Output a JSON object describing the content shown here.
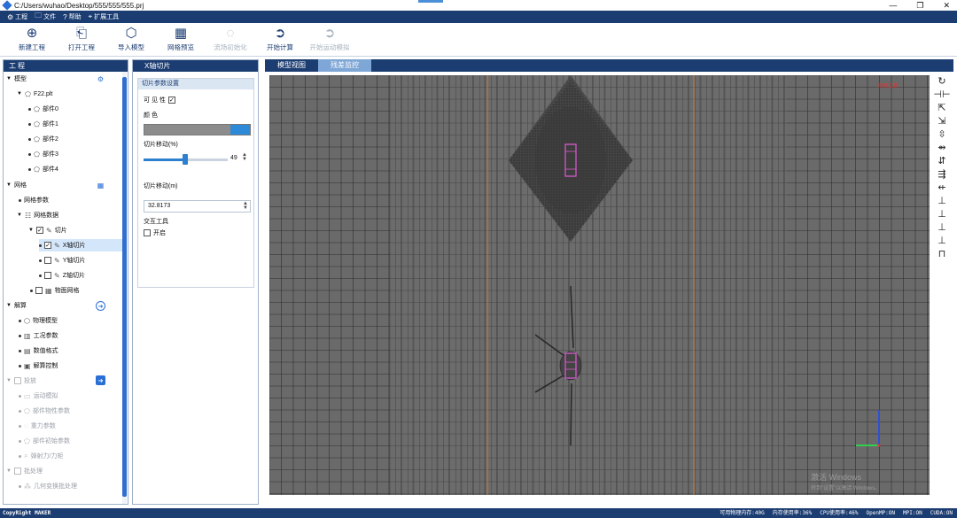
{
  "window": {
    "title": "C:/Users/wuhao/Desktop/555/555/555.prj",
    "controls": [
      "—",
      "❐",
      "✕"
    ]
  },
  "menu": [
    {
      "icon": "⚙",
      "label": "工程"
    },
    {
      "icon": "🗀",
      "label": "文件"
    },
    {
      "icon": "?",
      "label": "帮助"
    },
    {
      "icon": "⌖",
      "label": "扩展工具"
    }
  ],
  "toolbar": [
    {
      "icon": "⊕",
      "label": "新建工程",
      "enabled": true
    },
    {
      "icon": "⎗",
      "label": "打开工程",
      "enabled": true
    },
    {
      "icon": "⬡",
      "label": "导入模型",
      "enabled": true
    },
    {
      "icon": "▦",
      "label": "网格预览",
      "enabled": true
    },
    {
      "icon": "◌",
      "label": "流场初始化",
      "enabled": false
    },
    {
      "icon": "➲",
      "label": "开始计算",
      "enabled": true
    },
    {
      "icon": "➲",
      "label": "开始运动模拟",
      "enabled": false
    }
  ],
  "project_panel": {
    "title": "工程",
    "tree": {
      "model": "模型",
      "file": "F22.plt",
      "parts": [
        "部件0",
        "部件1",
        "部件2",
        "部件3",
        "部件4"
      ],
      "mesh": "网格",
      "mesh_params": "网格参数",
      "mesh_data": "网格数据",
      "slice": "切片",
      "x_slice": "X轴切片",
      "y_slice": "Y轴切片",
      "z_slice": "Z轴切片",
      "object_mesh": "物面网格",
      "solve": "解算",
      "physics_model": "物理模型",
      "conditions": "工况参数",
      "numeric_format": "数值格式",
      "solve_control": "解算控制",
      "motion": "投放",
      "motion_sim": "运动模拟",
      "part_props": "部件物性参数",
      "gravity": "重力参数",
      "part_init": "部件初始参数",
      "ejection": "弹射力/力矩",
      "batch": "批处理",
      "geo_batch": "几何变换批处理"
    }
  },
  "slice_panel": {
    "tab": "X轴切片",
    "group_title": "切片参数设置",
    "visible_label": "可 见 性",
    "visible_checked": true,
    "color_label": "颜      色",
    "color_value": "#2d8ad8",
    "move_pct_label": "切片移动(%)",
    "move_pct_value": "49",
    "move_pct_fraction": 0.49,
    "move_m_label": "切片移动(m)",
    "move_m_value": "32.8173",
    "interact_label": "交互工具",
    "enable_label": "开启",
    "enable_checked": false
  },
  "view_tabs": [
    "模型视图",
    "残差监控"
  ],
  "active_view_tab": 1,
  "viewport": {
    "corner_tag": "网格工具",
    "watermark_title": "激活 Windows",
    "watermark_sub": "转到\"设置\"以激活 Windows。"
  },
  "right_tools": [
    "↻",
    "⊣⊢",
    "⇱",
    "⇲",
    "⇳",
    "⇴",
    "⇵",
    "⇶",
    "⇷",
    "⊥",
    "⊥",
    "⊥",
    "⊥",
    "⊓"
  ],
  "status": {
    "copyright": "CopyRight MAKER",
    "items": [
      "可用物理内存:40G",
      "内存使用率:36%",
      "CPU使用率:46%",
      "OpenMP:ON",
      "MPI:ON",
      "CUDA:ON"
    ]
  }
}
